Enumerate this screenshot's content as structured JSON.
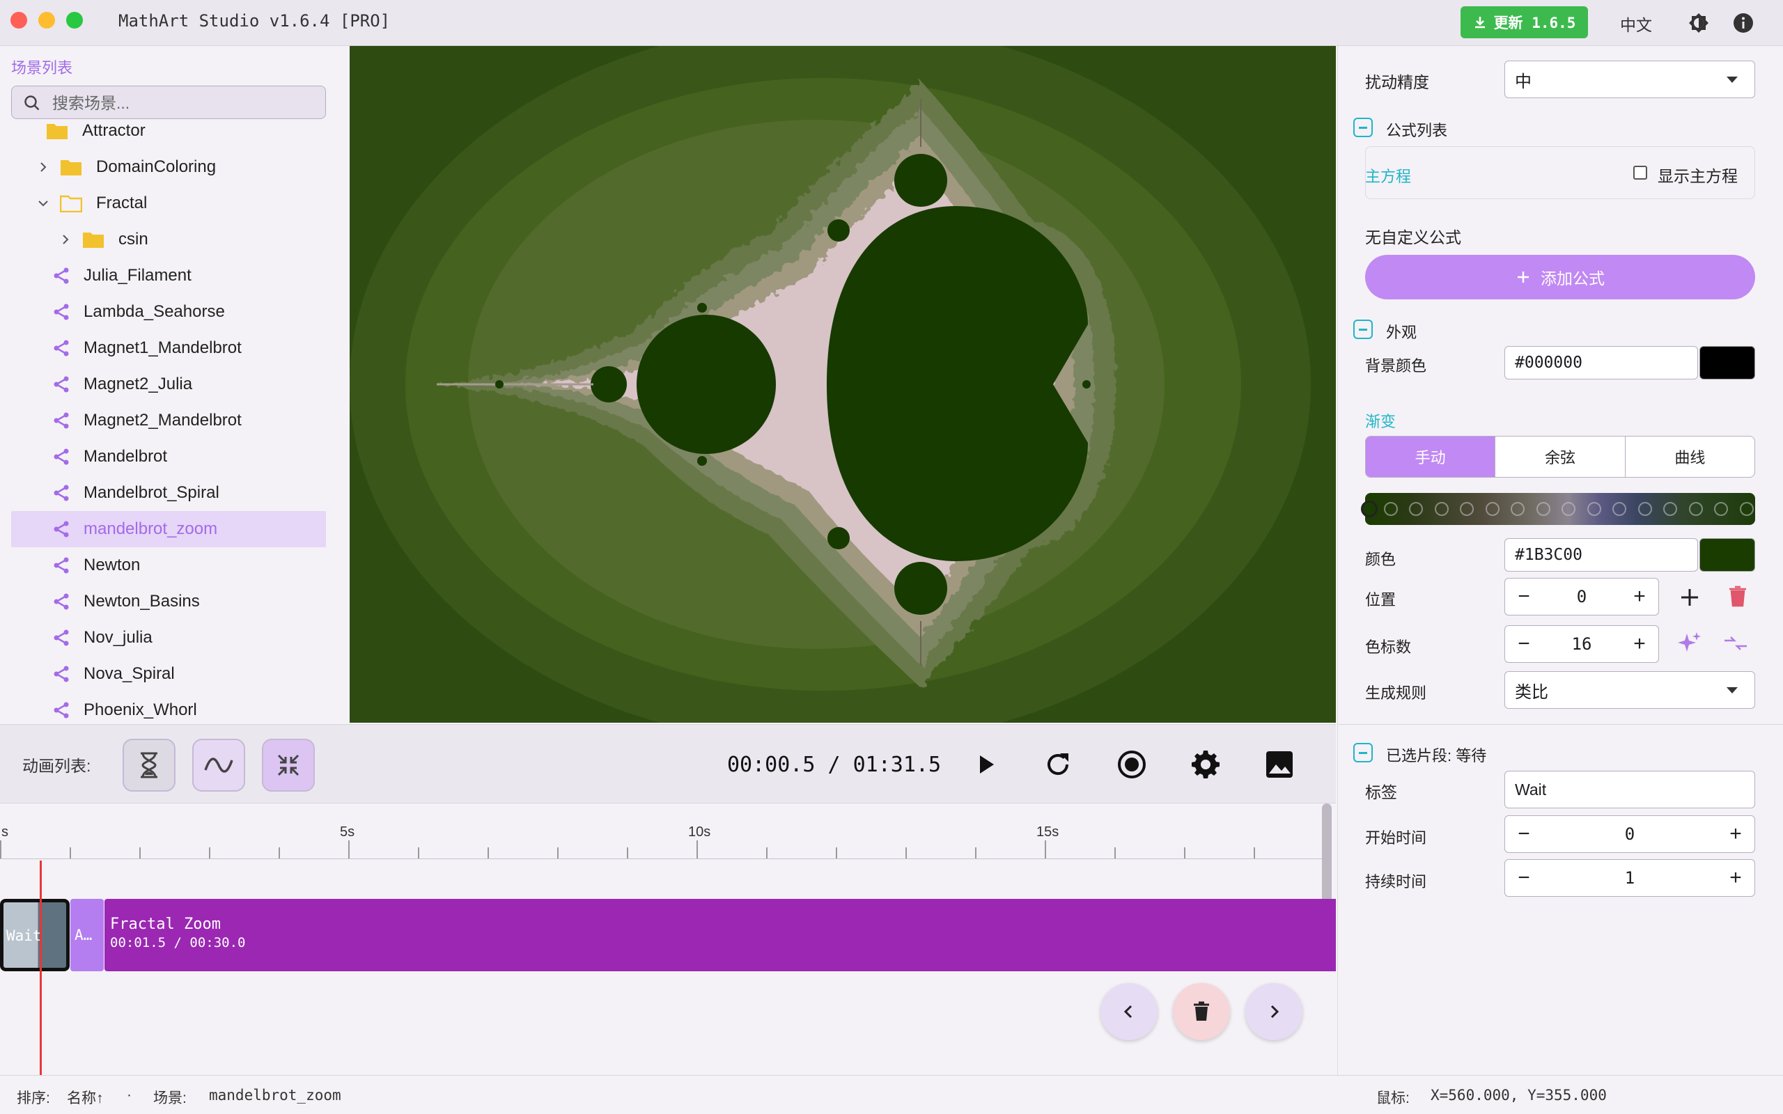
{
  "app": {
    "title": "MathArt Studio v1.6.4 [PRO]",
    "update_label": "更新 1.6.5",
    "language": "中文"
  },
  "sidebar": {
    "title": "场景列表",
    "search_placeholder": "搜索场景...",
    "tree": [
      {
        "label": "Attractor",
        "kind": "folder",
        "depth": 0,
        "partial": true
      },
      {
        "label": "DomainColoring",
        "kind": "folder",
        "depth": 0,
        "expanded": false
      },
      {
        "label": "Fractal",
        "kind": "folder",
        "depth": 0,
        "expanded": true
      },
      {
        "label": "csin",
        "kind": "folder",
        "depth": 1,
        "expanded": false
      },
      {
        "label": "Julia_Filament",
        "kind": "scene",
        "depth": 1
      },
      {
        "label": "Lambda_Seahorse",
        "kind": "scene",
        "depth": 1
      },
      {
        "label": "Magnet1_Mandelbrot",
        "kind": "scene",
        "depth": 1
      },
      {
        "label": "Magnet2_Julia",
        "kind": "scene",
        "depth": 1
      },
      {
        "label": "Magnet2_Mandelbrot",
        "kind": "scene",
        "depth": 1
      },
      {
        "label": "Mandelbrot",
        "kind": "scene",
        "depth": 1
      },
      {
        "label": "Mandelbrot_Spiral",
        "kind": "scene",
        "depth": 1
      },
      {
        "label": "mandelbrot_zoom",
        "kind": "scene",
        "depth": 1,
        "selected": true
      },
      {
        "label": "Newton",
        "kind": "scene",
        "depth": 1
      },
      {
        "label": "Newton_Basins",
        "kind": "scene",
        "depth": 1
      },
      {
        "label": "Nov_julia",
        "kind": "scene",
        "depth": 1
      },
      {
        "label": "Nova_Spiral",
        "kind": "scene",
        "depth": 1
      },
      {
        "label": "Phoenix_Whorl",
        "kind": "scene",
        "depth": 1
      }
    ]
  },
  "panel": {
    "perturbation_label": "扰动精度",
    "perturbation_value": "中",
    "formula_section": "公式列表",
    "main_equation_label": "主方程",
    "show_main_equation": "显示主方程",
    "no_custom_formula": "无自定义公式",
    "add_formula": "添加公式",
    "appearance_section": "外观",
    "bg_color_label": "背景颜色",
    "bg_color_value": "#000000",
    "gradient_label": "渐变",
    "gradient_modes": [
      "手动",
      "余弦",
      "曲线"
    ],
    "gradient_active": "手动",
    "color_label": "颜色",
    "color_value": "#1B3C00",
    "position_label": "位置",
    "position_value": "0",
    "stops_label": "色标数",
    "stops_value": "16",
    "rule_label": "生成规则",
    "rule_value": "类比"
  },
  "animation": {
    "list_label": "动画列表:",
    "timecode": "00:00.5 / 01:31.5",
    "ruler_labels": [
      "s",
      "5s",
      "10s",
      "15s"
    ],
    "clips": [
      {
        "label": "Wait",
        "sub": ""
      },
      {
        "label": "A…",
        "sub": ""
      },
      {
        "label": "Fractal Zoom",
        "sub": "00:01.5 / 00:30.0"
      }
    ]
  },
  "selected_clip": {
    "section": "已选片段: 等待",
    "tag_label": "标签",
    "tag_value": "Wait",
    "start_label": "开始时间",
    "start_value": "0",
    "duration_label": "持续时间",
    "duration_value": "1"
  },
  "status": {
    "sort_label": "排序:",
    "sort_value": "名称↑",
    "separator": "·",
    "scene_label": "场景:",
    "scene_value": "mandelbrot_zoom",
    "mouse_label": "鼠标:",
    "mouse_value": "X=560.000, Y=355.000"
  },
  "colors": {
    "accent": "#c189f3",
    "teal": "#1fb5c9",
    "clip_purple": "#9b27b3",
    "update_green": "#3dba4e",
    "fractal_dark": "#1b3c00"
  }
}
